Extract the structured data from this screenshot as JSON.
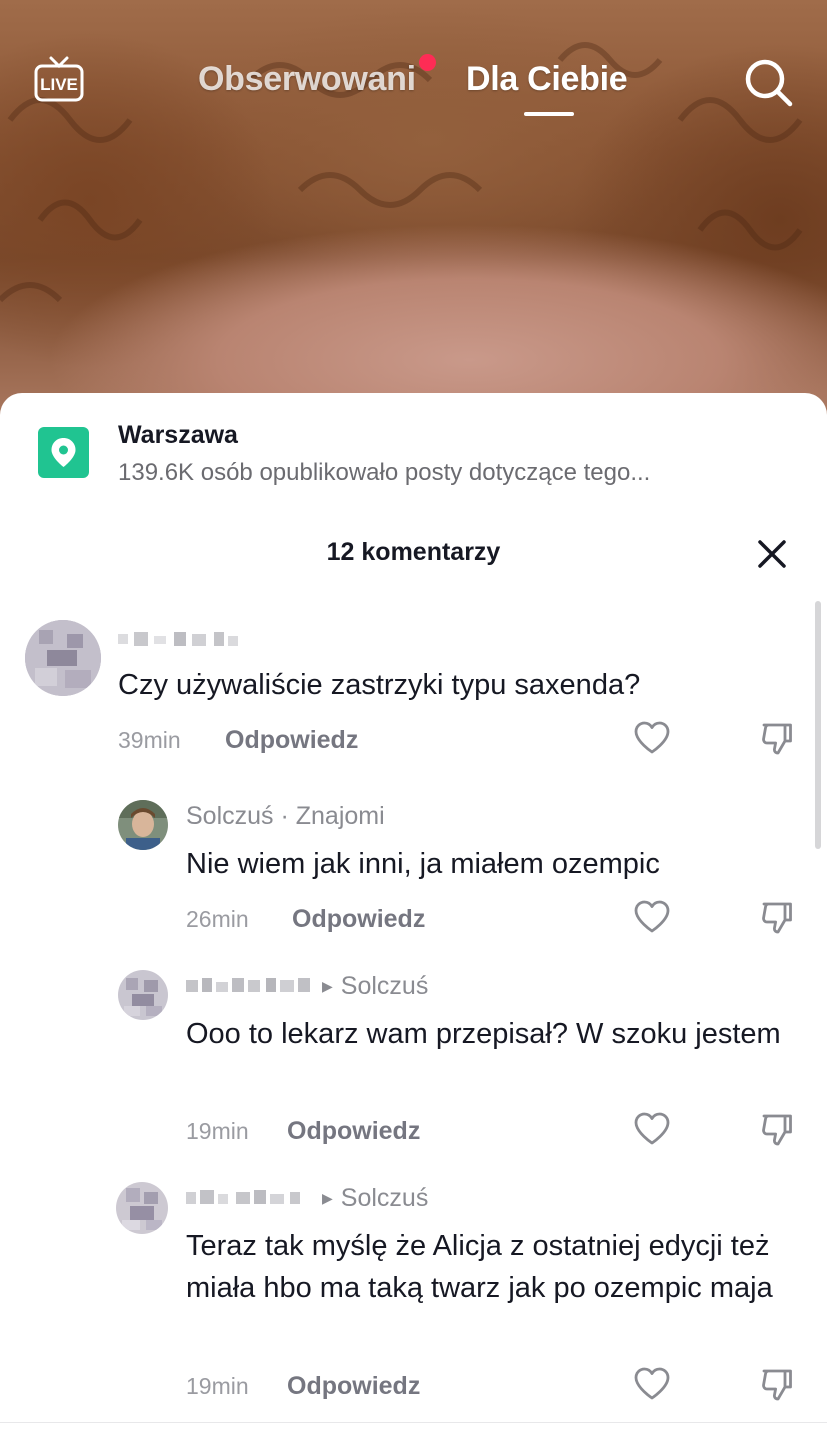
{
  "header": {
    "tab_following": "Obserwowani",
    "tab_foryou": "Dla Ciebie",
    "live_label": "LIVE",
    "notification_dot_color": "#fe2c55"
  },
  "location": {
    "title": "Warszawa",
    "subtitle": "139.6K osób opublikowało posty dotyczące tego...",
    "icon": "location-pin-icon",
    "badge_color": "#20c491"
  },
  "comments_panel": {
    "title": "12 komentarzy"
  },
  "comments": [
    {
      "author_visible": "",
      "reply_to": "",
      "text": "Czy używaliście zastrzyki typu saxenda?",
      "time": "39min",
      "reply_label": "Odpowiedz"
    },
    {
      "author_visible": "Solczuś · Znajomi",
      "reply_to": "",
      "text": "Nie wiem jak inni, ja miałem ozempic",
      "time": "26min",
      "reply_label": "Odpowiedz"
    },
    {
      "author_visible": "",
      "reply_to": "Solczuś",
      "text": "Ooo to lekarz wam przepisał? W szoku jestem",
      "time": "19min",
      "reply_label": "Odpowiedz"
    },
    {
      "author_visible": "",
      "reply_to": "Solczuś",
      "text": "Teraz tak myślę że Alicja z ostatniej edycji też miała hbo ma taką twarz jak po ozempic maja",
      "time": "19min",
      "reply_label": "Odpowiedz"
    }
  ]
}
